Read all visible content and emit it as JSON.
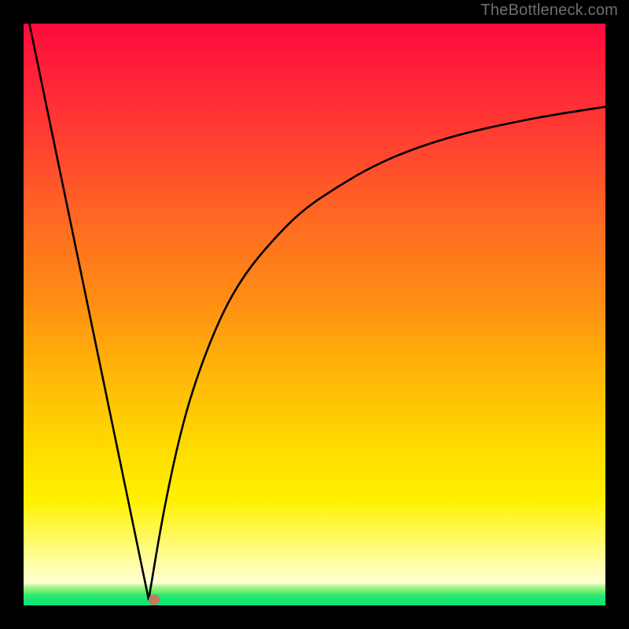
{
  "attribution": "TheBottleneck.com",
  "chart_data": {
    "type": "line",
    "title": "",
    "xlabel": "",
    "ylabel": "",
    "xlim": [
      0,
      100
    ],
    "ylim": [
      0,
      100
    ],
    "series": [
      {
        "name": "left-linear-segment",
        "x": [
          1,
          21.5
        ],
        "values": [
          100,
          1
        ]
      },
      {
        "name": "right-curve-segment",
        "x": [
          21.5,
          24,
          27,
          30,
          34,
          38,
          43,
          48,
          54,
          60,
          67,
          75,
          84,
          92,
          100
        ],
        "values": [
          1,
          16,
          30,
          40,
          50,
          57,
          63,
          68,
          72,
          75.5,
          78.5,
          81,
          83,
          84.5,
          85.7
        ]
      }
    ],
    "marker": {
      "x": 22.4,
      "y": 1.0,
      "color": "#c47a5e"
    },
    "background_gradient": {
      "type": "vertical",
      "stops": [
        {
          "pos": 0.0,
          "color": "#ff0a3d"
        },
        {
          "pos": 0.18,
          "color": "#ff3a33"
        },
        {
          "pos": 0.48,
          "color": "#ff8f14"
        },
        {
          "pos": 0.72,
          "color": "#ffd800"
        },
        {
          "pos": 0.9,
          "color": "#fffb7a"
        },
        {
          "pos": 0.965,
          "color": "#b7f99a"
        },
        {
          "pos": 1.0,
          "color": "#00e777"
        }
      ]
    }
  }
}
